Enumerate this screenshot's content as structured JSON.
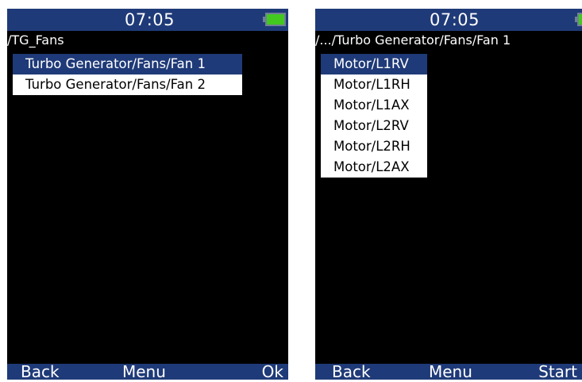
{
  "screens": [
    {
      "time": "07:05",
      "path": "/TG_Fans",
      "items": [
        {
          "label": "Turbo Generator/Fans/Fan 1",
          "selected": true
        },
        {
          "label": "Turbo Generator/Fans/Fan 2",
          "selected": false
        }
      ],
      "softkeys": {
        "left": "Back",
        "middle": "Menu",
        "right": "Ok"
      },
      "battery_icon": "battery-full-icon"
    },
    {
      "time": "07:05",
      "path": "/.../Turbo Generator/Fans/Fan 1",
      "items": [
        {
          "label": "Motor/L1RV",
          "selected": true
        },
        {
          "label": "Motor/L1RH",
          "selected": false
        },
        {
          "label": "Motor/L1AX",
          "selected": false
        },
        {
          "label": "Motor/L2RV",
          "selected": false
        },
        {
          "label": "Motor/L2RH",
          "selected": false
        },
        {
          "label": "Motor/L2AX",
          "selected": false
        }
      ],
      "softkeys": {
        "left": "Back",
        "middle": "Menu",
        "right": "Start"
      },
      "battery_icon": "battery-full-icon"
    }
  ],
  "colors": {
    "bar_blue": "#1f3a78",
    "screen_background": "#000000",
    "item_background": "#ffffff",
    "battery_green": "#43c820"
  }
}
